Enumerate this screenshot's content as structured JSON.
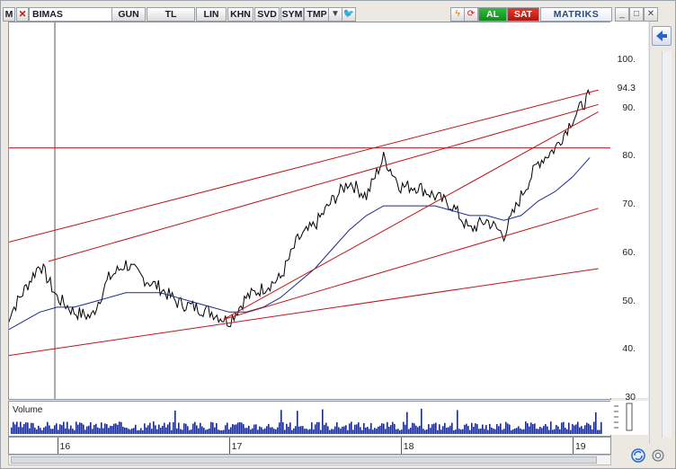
{
  "toolbar": {
    "menu_letter": "M",
    "symbol": "BIMAS",
    "period": "GUN",
    "currency": "TL",
    "scale": "LIN",
    "buttons": [
      "KHN",
      "SVD",
      "SYM",
      "TMP"
    ],
    "buy_label": "AL",
    "sell_label": "SAT",
    "brand": "MATRIKS",
    "window_controls": [
      "_",
      "□",
      "✕"
    ]
  },
  "chart": {
    "last_price": "94.3",
    "y_ticks": [
      "100.",
      "90.",
      "80.",
      "70.",
      "60.",
      "50.",
      "40.",
      "30"
    ],
    "x_ticks": [
      "16",
      "17",
      "18",
      "19"
    ],
    "volume_label": "Volume",
    "colors": {
      "price": "#000000",
      "moving_average": "#1a2a8c",
      "trendline": "#c0141a",
      "volume": "#1a2a8c"
    }
  },
  "chart_data": {
    "type": "line",
    "title": "",
    "xlabel": "",
    "ylabel": "",
    "ylim": [
      30,
      108
    ],
    "x": [
      15.7,
      15.8,
      15.9,
      16.0,
      16.1,
      16.2,
      16.3,
      16.4,
      16.5,
      16.6,
      16.7,
      16.8,
      16.9,
      17.0,
      17.1,
      17.2,
      17.3,
      17.4,
      17.5,
      17.6,
      17.7,
      17.8,
      17.9,
      18.0,
      18.1,
      18.2,
      18.3,
      18.4,
      18.5,
      18.6,
      18.7,
      18.8,
      18.9,
      19.0,
      19.1
    ],
    "series": [
      {
        "values": [
          46,
          52,
          58,
          51,
          48,
          47,
          55,
          58,
          55,
          53,
          50,
          49,
          48,
          46,
          51,
          53,
          55,
          63,
          66,
          71,
          75,
          72,
          80,
          74,
          74,
          72,
          70,
          65,
          67,
          64,
          72,
          79,
          82,
          88,
          93
        ]
      },
      {
        "values": [
          44,
          46,
          48,
          49,
          49,
          50,
          51,
          52,
          52,
          52,
          51,
          50,
          49,
          48,
          48,
          49,
          51,
          54,
          57,
          61,
          65,
          68,
          70,
          70,
          70,
          70,
          69,
          68,
          68,
          67,
          68,
          71,
          73,
          76,
          80
        ]
      }
    ],
    "volume_present": true,
    "horizontal_line": 82,
    "grid": false
  }
}
